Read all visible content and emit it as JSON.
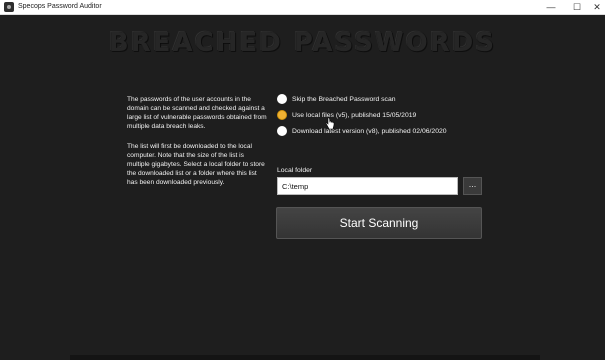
{
  "window": {
    "title": "Specops Password Auditor",
    "minimize": "—",
    "maximize": "☐",
    "close": "✕"
  },
  "banner": {
    "title": "BREACHED PASSWORDS"
  },
  "description": {
    "paragraph1": "The passwords of the user accounts in the domain can be scanned and checked against a large list of vulnerable passwords obtained from multiple data breach leaks.",
    "paragraph2": "The list will first be downloaded to the local computer. Note that the size of the list is multiple gigabytes. Select a local folder to store the downloaded list or a folder where this list has been downloaded previously."
  },
  "options": [
    {
      "label": "Skip the Breached Password scan",
      "selected": false
    },
    {
      "label": "Use local files (v5), published 15/05/2019",
      "selected": true
    },
    {
      "label": "Download latest version (v8), published 02/06/2020",
      "selected": false
    }
  ],
  "local_folder": {
    "label": "Local folder",
    "value": "C:\\temp",
    "browse_label": "..."
  },
  "scan_button": {
    "label": "Start Scanning"
  },
  "colors": {
    "accent": "#f0b233",
    "background": "#1e1e1e"
  }
}
